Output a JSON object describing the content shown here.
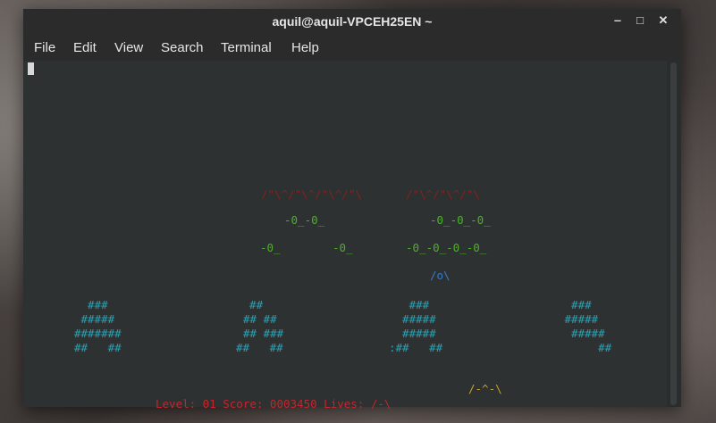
{
  "window": {
    "title": "aquil@aquil-VPCEH25EN ~",
    "minimize": "‒",
    "maximize": "□",
    "close": "✕"
  },
  "menu": {
    "items": [
      "File",
      "Edit",
      "View",
      "Search",
      "Terminal",
      "Help"
    ]
  },
  "game": {
    "mothership_left": "/\"\\^/\"\\^/\"\\^/\"\\",
    "mothership_right": "/\"\\^/\"\\^/\"\\",
    "aliens_row1_left": "-0_-0_",
    "aliens_row1_right": "-0_-0_-0_",
    "aliens_row2_a": "-0_",
    "aliens_row2_b": "-0_",
    "aliens_row2_c": "-0_-0_-0_-0_",
    "bomb": "/o\\",
    "bunkers": [
      [
        "  ###",
        " #####",
        "#######",
        "##   ##"
      ],
      [
        "  ##",
        "## ##",
        "## ###",
        "##   ##"
      ],
      [
        "   ###",
        "  #####",
        "  #####",
        ":##   ##"
      ],
      [
        "  ###",
        " #####",
        "  #####",
        "      ##"
      ]
    ],
    "player": "/-^-\\",
    "status": "Level: 01 Score: 0003450 Lives: /-\\"
  },
  "colors": {
    "mothership": "#8a1f22",
    "aliens": "#4fae2f",
    "bomb": "#3a7bc8",
    "bunkers": "#2aa1b3",
    "player": "#c9a227",
    "status": "#c1272d"
  }
}
